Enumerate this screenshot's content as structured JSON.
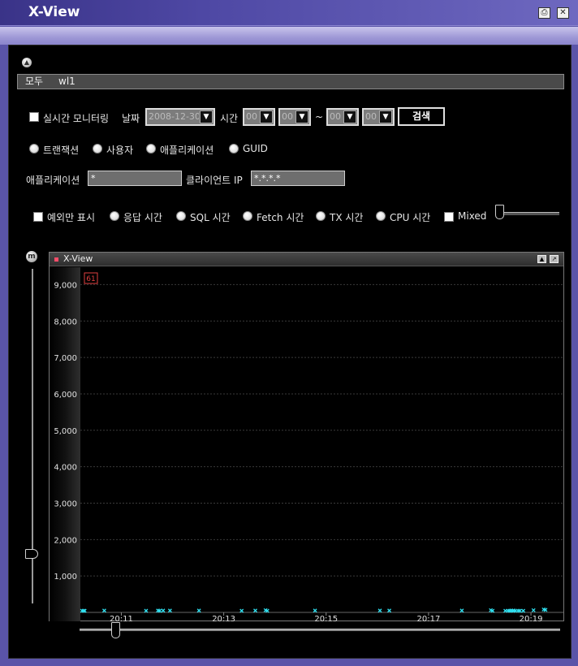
{
  "window": {
    "title": "X-View",
    "print_icon": "printer-icon",
    "close_icon": "close-icon"
  },
  "filterbar": {
    "scope": "모두",
    "server": "wl1"
  },
  "controls": {
    "realtime_label": "실시간 모니터링",
    "date_label": "날짜",
    "date_value": "2008-12-30",
    "time_label": "시간",
    "from_hour": "00",
    "from_min": "00",
    "tilde": "~",
    "to_hour": "00",
    "to_min": "00",
    "search_label": "검색"
  },
  "mode_radios": [
    {
      "label": "트랜잭션"
    },
    {
      "label": "사용자"
    },
    {
      "label": "애플리케이션"
    },
    {
      "label": "GUID"
    }
  ],
  "fields": {
    "app_label": "애플리케이션",
    "app_value": "*",
    "client_ip_label": "클라이언트 IP",
    "client_ip_value": "*.*.*.*"
  },
  "options": {
    "exception_only": "예외만 표시",
    "radios": [
      {
        "label": "응답 시간"
      },
      {
        "label": "SQL 시간"
      },
      {
        "label": "Fetch 시간"
      },
      {
        "label": "TX 시간"
      },
      {
        "label": "CPU 시간"
      }
    ],
    "mixed": "Mixed"
  },
  "chart_panel": {
    "title": "X-View",
    "m_button": "m",
    "count_badge": "61"
  },
  "colors": {
    "point": "#2fe0f0",
    "badge": "#e04040",
    "grid": "#3a3a3a"
  },
  "chart_data": {
    "type": "scatter",
    "title": "",
    "xlabel": "",
    "ylabel": "",
    "ylim": [
      0,
      9500
    ],
    "y_ticks": [
      1000,
      2000,
      3000,
      4000,
      5000,
      6000,
      7000,
      8000,
      9000
    ],
    "y_tick_labels": [
      "1,000",
      "2,000",
      "3,000",
      "4,000",
      "5,000",
      "6,000",
      "7,000",
      "8,000",
      "9,000"
    ],
    "xlim": [
      "20:10:12",
      "20:19:38"
    ],
    "x_tick_labels": [
      "20:11",
      "20:13",
      "20:15",
      "20:17",
      "20:19"
    ],
    "x_ticks": [
      "20:11:00",
      "20:13:00",
      "20:15:00",
      "20:17:00",
      "20:19:00"
    ],
    "grid": true,
    "points": [
      {
        "x": "20:10:14",
        "y": 40
      },
      {
        "x": "20:10:16",
        "y": 40
      },
      {
        "x": "20:10:17",
        "y": 40
      },
      {
        "x": "20:10:40",
        "y": 50
      },
      {
        "x": "20:11:29",
        "y": 40
      },
      {
        "x": "20:11:43",
        "y": 50
      },
      {
        "x": "20:11:45",
        "y": 40
      },
      {
        "x": "20:11:49",
        "y": 50
      },
      {
        "x": "20:11:57",
        "y": 50
      },
      {
        "x": "20:12:31",
        "y": 50
      },
      {
        "x": "20:13:21",
        "y": 40
      },
      {
        "x": "20:13:37",
        "y": 50
      },
      {
        "x": "20:13:49",
        "y": 60
      },
      {
        "x": "20:13:51",
        "y": 40
      },
      {
        "x": "20:14:47",
        "y": 50
      },
      {
        "x": "20:16:03",
        "y": 50
      },
      {
        "x": "20:16:14",
        "y": 50
      },
      {
        "x": "20:17:39",
        "y": 50
      },
      {
        "x": "20:18:13",
        "y": 60
      },
      {
        "x": "20:18:15",
        "y": 40
      },
      {
        "x": "20:18:30",
        "y": 40
      },
      {
        "x": "20:18:33",
        "y": 40
      },
      {
        "x": "20:18:35",
        "y": 40
      },
      {
        "x": "20:18:37",
        "y": 50
      },
      {
        "x": "20:18:39",
        "y": 40
      },
      {
        "x": "20:18:40",
        "y": 50
      },
      {
        "x": "20:18:42",
        "y": 40
      },
      {
        "x": "20:18:45",
        "y": 40
      },
      {
        "x": "20:18:47",
        "y": 40
      },
      {
        "x": "20:18:51",
        "y": 40
      },
      {
        "x": "20:19:03",
        "y": 60
      },
      {
        "x": "20:19:15",
        "y": 80
      },
      {
        "x": "20:19:17",
        "y": 70
      }
    ]
  }
}
